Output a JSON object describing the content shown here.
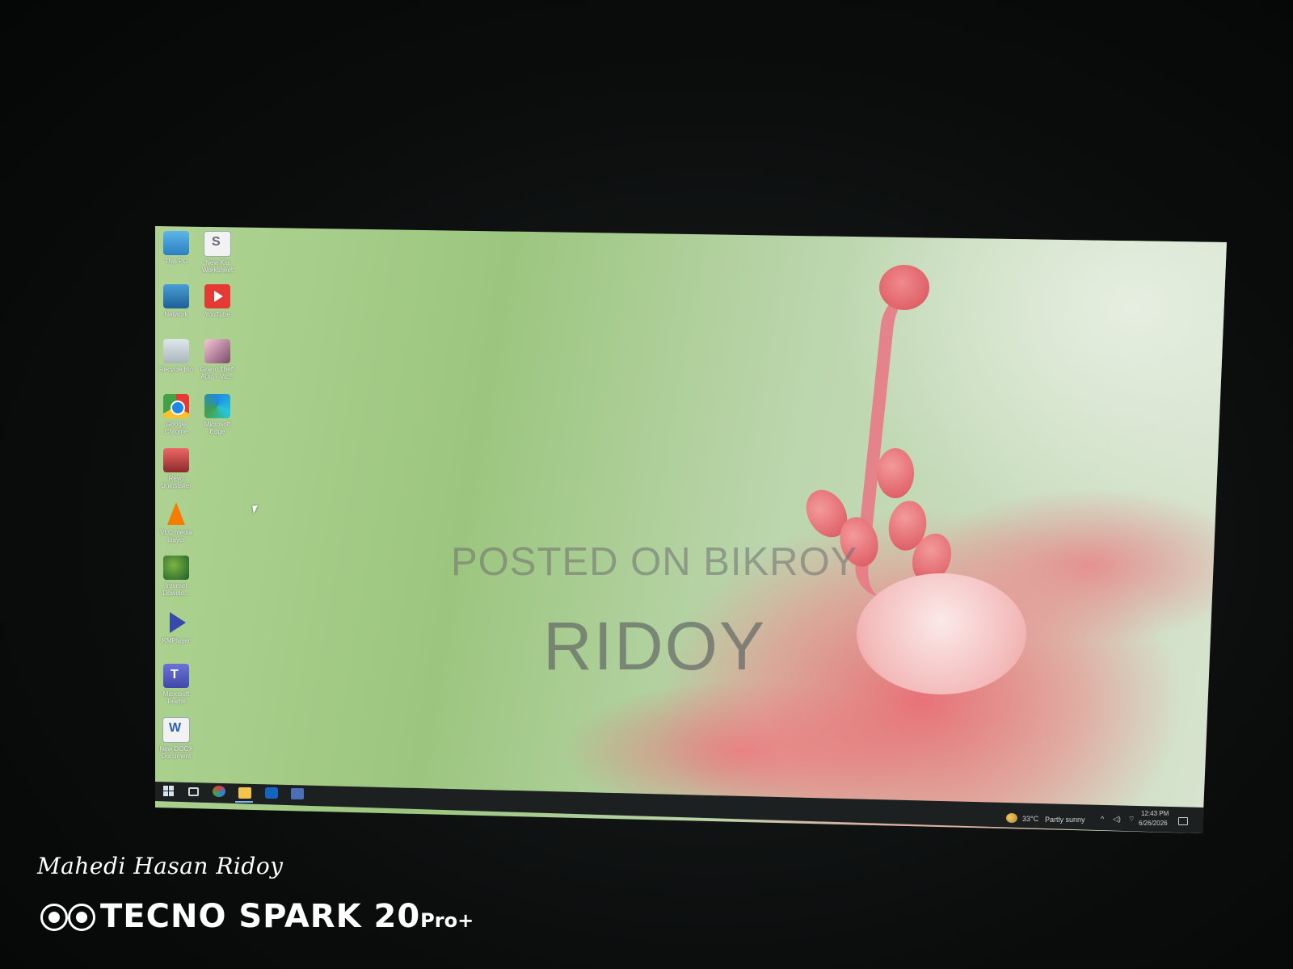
{
  "desktop": {
    "icons": [
      {
        "label": "This PC",
        "icon": "computer-icon"
      },
      {
        "label": "New Kia Worksheet",
        "icon": "document-icon"
      },
      {
        "label": "Network",
        "icon": "network-icon"
      },
      {
        "label": "YouTube",
        "icon": "youtube-icon"
      },
      {
        "label": "Recycle Bin",
        "icon": "recycle-bin-icon"
      },
      {
        "label": "Grand Theft Auto - Vic...",
        "icon": "game-icon"
      },
      {
        "label": "Google Chrome",
        "icon": "chrome-icon"
      },
      {
        "label": "Microsoft Edge",
        "icon": "edge-icon"
      },
      {
        "label": "Revo Uninstaller",
        "icon": "uninstaller-icon"
      },
      {
        "label": "VLC media player",
        "icon": "vlc-icon"
      },
      {
        "label": "Internet Downlo...",
        "icon": "download-manager-icon"
      },
      {
        "label": "KMPlayer",
        "icon": "media-player-icon"
      },
      {
        "label": "Microsoft Teams",
        "icon": "teams-icon"
      },
      {
        "label": "New DOCX Document",
        "icon": "word-document-icon"
      }
    ]
  },
  "watermark": {
    "line1": "POSTED ON BIKROY",
    "line2": "RIDOY"
  },
  "taskbar": {
    "apps": [
      "start-icon",
      "camera-icon",
      "edge-icon",
      "file-explorer-icon",
      "outlook-icon",
      "store-icon"
    ],
    "weather": {
      "temp": "33°C",
      "condition": "Partly sunny"
    },
    "time": "12:43 PM",
    "date": "6/26/2026"
  },
  "photo_overlay": {
    "signature": "Mahedi Hasan Ridoy",
    "brand": "TECNO SPARK 20",
    "brand_suffix": "Pro+"
  },
  "colors": {
    "wallpaper_green": "#a9cf8c",
    "flower_pink": "#e87a86",
    "taskbar": "#1a1d1e"
  }
}
